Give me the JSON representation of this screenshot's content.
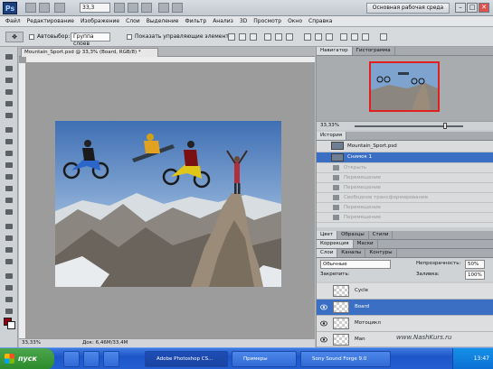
{
  "appbar": {
    "logo": "Ps",
    "zoom_value": "33,3",
    "workspace": "Основная рабочая среда",
    "win_min": "–",
    "win_max": "□",
    "win_close": "✕"
  },
  "menu": [
    "Файл",
    "Редактирование",
    "Изображение",
    "Слои",
    "Выделение",
    "Фильтр",
    "Анализ",
    "3D",
    "Просмотр",
    "Окно",
    "Справка"
  ],
  "options": {
    "tool_icon": "move-tool-icon",
    "auto_select_label": "Автовыбор:",
    "auto_select_value": "Группа слоев",
    "transform_label": "Показать управляющие элементы"
  },
  "document": {
    "tab_title": "Mountain_Sport.psd @ 33,3% (Board, RGB/8) *",
    "status_zoom": "33,33%",
    "status_info": "Док: 6,46M/33,4M"
  },
  "navigator": {
    "tabs": [
      "Навигатор",
      "Гистограмма"
    ],
    "zoom": "33,33%"
  },
  "history": {
    "tabs": [
      "История"
    ],
    "snapshot": "Mountain_Sport.psd",
    "items": [
      {
        "label": "Снимок 1",
        "state": "selected"
      },
      {
        "label": "Открыть",
        "state": "dim"
      },
      {
        "label": "Перемещение",
        "state": "dim"
      },
      {
        "label": "Перемещение",
        "state": "dim"
      },
      {
        "label": "Свободное трансформирование",
        "state": "dim"
      },
      {
        "label": "Перемещение",
        "state": "dim"
      },
      {
        "label": "Перемещение",
        "state": "dim"
      }
    ]
  },
  "mid_tabs": [
    "Цвет",
    "Образцы",
    "Стили"
  ],
  "mid_tabs2": [
    "Коррекция",
    "Маски"
  ],
  "layers": {
    "tabs": [
      "Слои",
      "Каналы",
      "Контуры"
    ],
    "blend_mode": "Обычные",
    "opacity_label": "Непрозрачность:",
    "opacity_value": "50%",
    "lock_label": "Закрепить:",
    "fill_label": "Заливка:",
    "fill_value": "100%",
    "items": [
      {
        "name": "Cycle",
        "visible": false,
        "selected": false
      },
      {
        "name": "Board",
        "visible": true,
        "selected": true
      },
      {
        "name": "Мотоцикл",
        "visible": true,
        "selected": false
      },
      {
        "name": "Man",
        "visible": true,
        "selected": false
      }
    ]
  },
  "watermark": "www.NashKurs.ru",
  "taskbar": {
    "start": "пуск",
    "buttons": [
      "Adobe Photoshop CS...",
      "Примеры",
      "Sony Sound Forge 9.0"
    ],
    "clock": "13:47"
  }
}
